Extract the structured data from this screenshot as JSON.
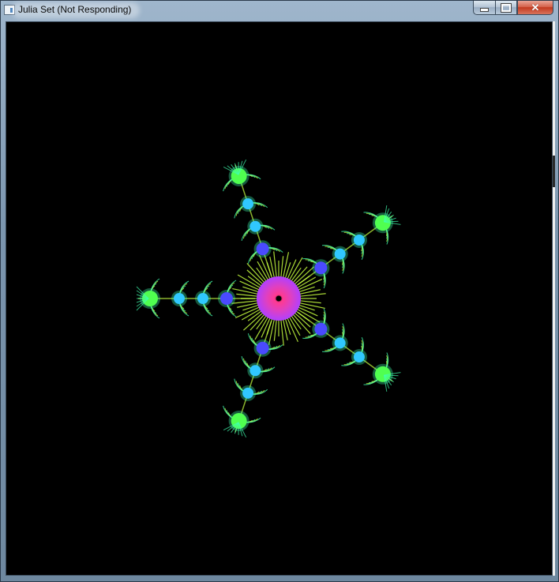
{
  "window": {
    "title": "Julia Set (Not Responding)",
    "icon": "app-window-icon"
  },
  "caption_buttons": {
    "minimize_icon": "minimize-icon",
    "maximize_icon": "maximize-icon",
    "close_glyph": "✕"
  },
  "fractal": {
    "name": "julia-set",
    "arm_count": 5,
    "colors": {
      "background": "#000000",
      "center_outer": "#b040ff",
      "center_mid": "#e040c0",
      "center_inner": "#ff3a90",
      "filament": "#c8ff40",
      "bulb_near": "#4a4aff",
      "bulb_mid": "#30c8ff",
      "bulb_far": "#50ff50",
      "fringe": "#40ffb0"
    }
  }
}
